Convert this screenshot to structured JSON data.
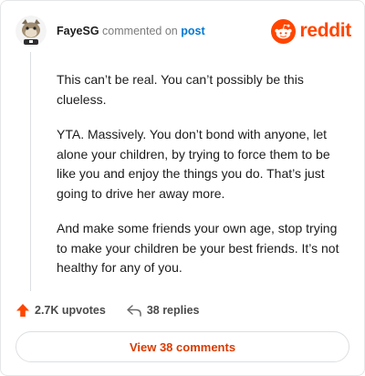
{
  "header": {
    "username": "FayeSG",
    "action_text": "commented on",
    "post_link": "post",
    "brand_word": "reddit"
  },
  "comment": {
    "paragraphs": [
      "This can’t be real. You can’t possibly be this clueless.",
      "YTA. Massively. You don’t bond with anyone, let alone your children, by trying to force them to be like you and enjoy the things you do. That’s just going to drive her away more.",
      "And make some friends your own age, stop trying to make your children be your best friends. It’s not healthy for any of you."
    ]
  },
  "actions": {
    "upvotes": "2.7K upvotes",
    "replies": "38 replies"
  },
  "footer": {
    "view_comments": "View 38 comments"
  },
  "colors": {
    "reddit_orange": "#ff4500",
    "link_blue": "#0079d3",
    "upvote_orange": "#ff4500",
    "button_text": "#d93a00"
  }
}
